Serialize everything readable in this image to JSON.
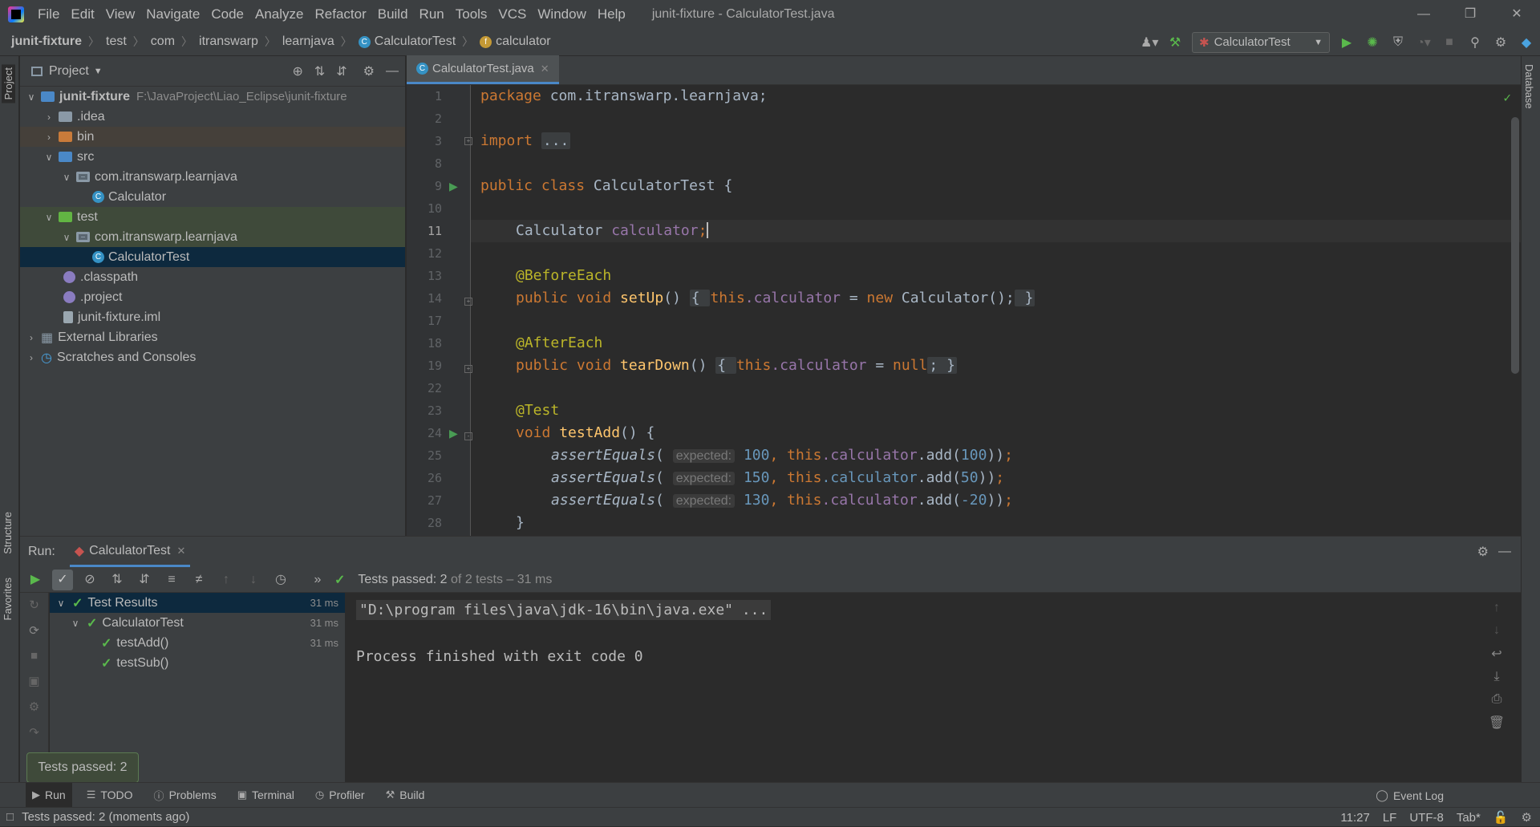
{
  "window": {
    "title": "junit-fixture - CalculatorTest.java"
  },
  "menu": [
    "File",
    "Edit",
    "View",
    "Navigate",
    "Code",
    "Analyze",
    "Refactor",
    "Build",
    "Run",
    "Tools",
    "VCS",
    "Window",
    "Help"
  ],
  "breadcrumb": [
    "junit-fixture",
    "test",
    "com",
    "itranswarp",
    "learnjava",
    "CalculatorTest",
    "calculator"
  ],
  "toolbar": {
    "run_config": "CalculatorTest"
  },
  "sidestrip": {
    "left_top": "Project",
    "left_mid": "Structure",
    "left_bottom": "Favorites",
    "right": "Database"
  },
  "project": {
    "title": "Project",
    "root": {
      "name": "junit-fixture",
      "path": "F:\\JavaProject\\Liao_Eclipse\\junit-fixture"
    },
    "items": [
      ".idea",
      "bin",
      "src",
      "com.itranswarp.learnjava",
      "Calculator",
      "test",
      "com.itranswarp.learnjava",
      "CalculatorTest",
      ".classpath",
      ".project",
      "junit-fixture.iml",
      "External Libraries",
      "Scratches and Consoles"
    ]
  },
  "editor": {
    "tab": "CalculatorTest.java",
    "line_numbers": [
      "1",
      "2",
      "3",
      "8",
      "9",
      "10",
      "11",
      "12",
      "13",
      "14",
      "17",
      "18",
      "19",
      "22",
      "23",
      "24",
      "25",
      "26",
      "27",
      "28"
    ],
    "code": {
      "l1_kw": "package",
      "l1_rest": " com.itranswarp.learnjava;",
      "l3_kw": "import",
      "l3_fold": "...",
      "l9_kw": "public class",
      "l9_rest": " CalculatorTest {",
      "l11_type": "Calculator ",
      "l11_field": "calculator",
      "l13": "@BeforeEach",
      "l14_kw": "public void ",
      "l14_fn": "setUp",
      "l14_a": "() ",
      "l14_b": "{ ",
      "l14_this": "this",
      "l14_f": ".calculator",
      "l14_c": " = ",
      "l14_new": "new",
      "l14_d": " Calculator();",
      "l14_e": " }",
      "l18": "@AfterEach",
      "l19_kw": "public void ",
      "l19_fn": "tearDown",
      "l19_a": "() ",
      "l19_b": "{ ",
      "l19_this": "this",
      "l19_f": ".calculator",
      "l19_c": " = ",
      "l19_null": "null",
      "l19_e": "; }",
      "l23": "@Test",
      "l24_kw": "void ",
      "l24_fn": "testAdd",
      "l24_rest": "() {",
      "assert_fn": "assertEquals",
      "hint": "expected:",
      "l25_v": "100",
      "l25_arg": "100",
      "l26_v": "150",
      "l26_arg": "50",
      "l27_v": "130",
      "l27_arg": "-20",
      "l28": "}"
    }
  },
  "run": {
    "label": "Run:",
    "tab": "CalculatorTest",
    "status_bold": "Tests passed: 2",
    "status_dim": "of 2 tests – 31 ms",
    "tree": [
      {
        "name": "Test Results",
        "time": "31 ms"
      },
      {
        "name": "CalculatorTest",
        "time": "31 ms"
      },
      {
        "name": "testAdd()",
        "time": "31 ms"
      },
      {
        "name": "testSub()",
        "time": ""
      }
    ],
    "console": {
      "cmd": "\"D:\\program files\\java\\jdk-16\\bin\\java.exe\" ...",
      "exit": "Process finished with exit code 0"
    }
  },
  "tooltip": "Tests passed: 2",
  "bottom_tabs": [
    "Run",
    "TODO",
    "Problems",
    "Terminal",
    "Profiler",
    "Build"
  ],
  "event_log": "Event Log",
  "status": {
    "message": "Tests passed: 2 (moments ago)",
    "position": "11:27",
    "line_sep": "LF",
    "encoding": "UTF-8",
    "indent": "Tab*"
  }
}
